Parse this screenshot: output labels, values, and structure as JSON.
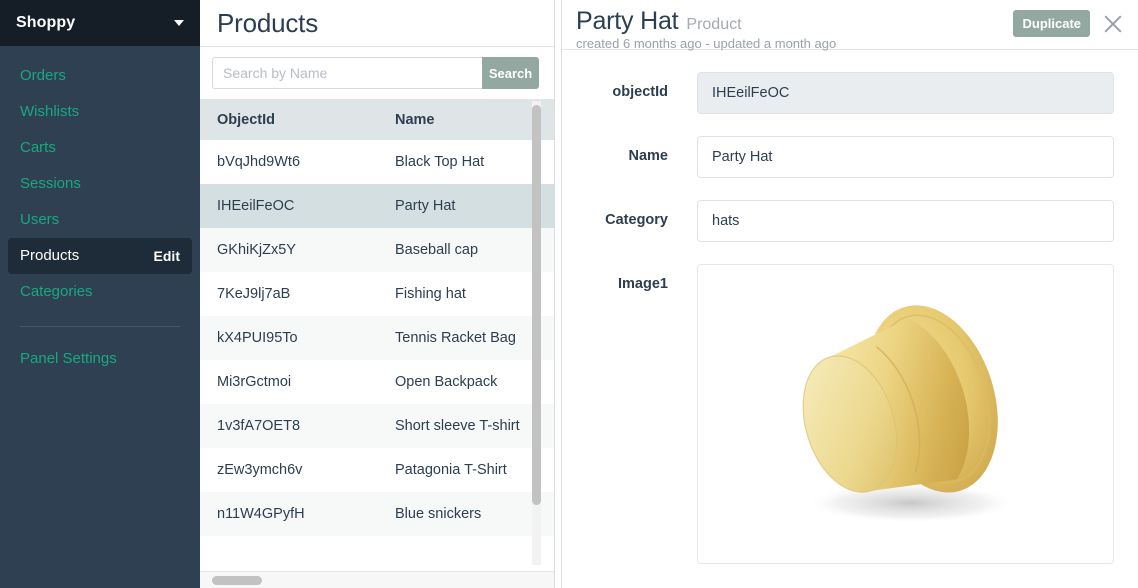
{
  "sidebar": {
    "brand": "Shoppy",
    "brand_caret_icon": "chevron-down-icon",
    "items": [
      {
        "label": "Orders",
        "active": false
      },
      {
        "label": "Wishlists",
        "active": false
      },
      {
        "label": "Carts",
        "active": false
      },
      {
        "label": "Sessions",
        "active": false
      },
      {
        "label": "Users",
        "active": false
      },
      {
        "label": "Products",
        "active": true,
        "action_label": "Edit"
      },
      {
        "label": "Categories",
        "active": false
      }
    ],
    "footer_items": [
      {
        "label": "Panel Settings"
      }
    ],
    "colors": {
      "bg": "#2e4052",
      "brand_bg": "#151d26",
      "link": "#18a97f",
      "active_bg": "#1e2b38"
    }
  },
  "list_panel": {
    "title": "Products",
    "search": {
      "placeholder": "Search by Name",
      "value": "",
      "button_label": "Search",
      "button_color": "#93a8a1"
    },
    "columns": [
      "ObjectId",
      "Name"
    ],
    "rows": [
      {
        "objectId": "bVqJhd9Wt6",
        "name": "Black Top Hat",
        "selected": false
      },
      {
        "objectId": "IHEeilFeOC",
        "name": "Party Hat",
        "selected": true
      },
      {
        "objectId": "GKhiKjZx5Y",
        "name": "Baseball cap",
        "selected": false
      },
      {
        "objectId": "7KeJ9lj7aB",
        "name": "Fishing hat",
        "selected": false
      },
      {
        "objectId": "kX4PUI95To",
        "name": "Tennis Racket Bag",
        "selected": false
      },
      {
        "objectId": "Mi3rGctmoi",
        "name": "Open Backpack",
        "selected": false
      },
      {
        "objectId": "1v3fA7OET8",
        "name": "Short sleeve T-shirt",
        "selected": false
      },
      {
        "objectId": "zEw3ymch6v",
        "name": "Patagonia T-Shirt",
        "selected": false
      },
      {
        "objectId": "n11W4GPyfH",
        "name": "Blue snickers",
        "selected": false
      }
    ]
  },
  "detail_panel": {
    "title": "Party Hat",
    "type_label": "Product",
    "subtitle": "created 6 months ago - updated a month ago",
    "duplicate_label": "Duplicate",
    "close_icon": "close-icon",
    "fields": [
      {
        "label": "objectId",
        "value": "IHEeilFeOC",
        "readonly": true,
        "kind": "text"
      },
      {
        "label": "Name",
        "value": "Party Hat",
        "readonly": false,
        "kind": "text"
      },
      {
        "label": "Category",
        "value": "hats",
        "readonly": false,
        "kind": "text"
      },
      {
        "label": "Image1",
        "value": "",
        "readonly": false,
        "kind": "image",
        "image_name": "gold-party-hat-photo"
      }
    ]
  },
  "scrollbars": {
    "list_vertical": {
      "thumb_color": "#c2c2c2"
    },
    "list_horizontal": {
      "thumb_color": "#c2c2c2"
    }
  }
}
